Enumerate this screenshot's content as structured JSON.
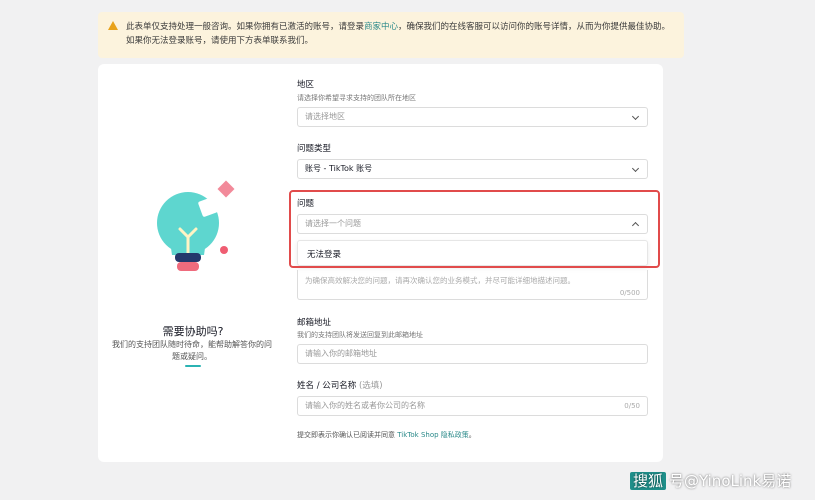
{
  "notice": {
    "text_before": "此表单仅支持处理一般咨询。如果你拥有已激活的账号，请登录",
    "link": "商家中心",
    "text_after": "，确保我们的在线客服可以访问你的账号详情，从而为你提供最佳协助。如果你无法登录账号，请使用下方表单联系我们。"
  },
  "help": {
    "title": "需要协助吗?",
    "description": "我们的支持团队随时待命，能帮助解答你的问题或疑问。"
  },
  "region": {
    "label": "地区",
    "hint": "请选择你希望寻求支持的团队所在地区",
    "placeholder": "请选择地区"
  },
  "issue_type": {
    "label": "问题类型",
    "value": "账号 - TikTok 账号"
  },
  "question": {
    "label": "问题",
    "placeholder": "请选择一个问题",
    "options": [
      "无法登录"
    ]
  },
  "details": {
    "placeholder": "为确保高效解决您的问题，请再次确认您的业务模式，并尽可能详细地描述问题。",
    "counter": "0/500"
  },
  "email": {
    "label": "邮箱地址",
    "hint": "我们的支持团队将发送回复到此邮箱地址",
    "placeholder": "请输入你的邮箱地址"
  },
  "name": {
    "label": "姓名 / 公司名称",
    "optional": "(选填)",
    "placeholder": "请输入你的姓名或者你公司的名称",
    "counter": "0/50"
  },
  "consent": {
    "text": "提交即表示你确认已阅读并同意 ",
    "link": "TikTok Shop 隐私政策",
    "end": "。"
  },
  "watermark": {
    "brand": "搜狐",
    "text": "号@YinoLink易诺"
  },
  "colors": {
    "accent": "#2b8a8a",
    "highlight": "#e14b4b",
    "bulb": "#5ed6cf"
  }
}
